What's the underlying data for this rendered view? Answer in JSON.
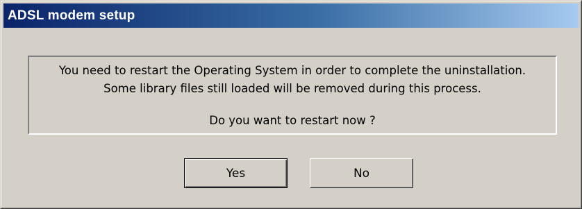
{
  "window": {
    "title": "ADSL modem setup"
  },
  "message": {
    "line1": "You need to restart the Operating System in order to complete the uninstallation.",
    "line2": "Some library files still loaded will be removed during this process.",
    "line3": "Do you want to restart now ?"
  },
  "buttons": {
    "yes_label": "Yes",
    "no_label": "No"
  },
  "colors": {
    "titlebar_start": "#0a246a",
    "titlebar_end": "#a6caf0",
    "dialog_background": "#d4d0c8"
  }
}
